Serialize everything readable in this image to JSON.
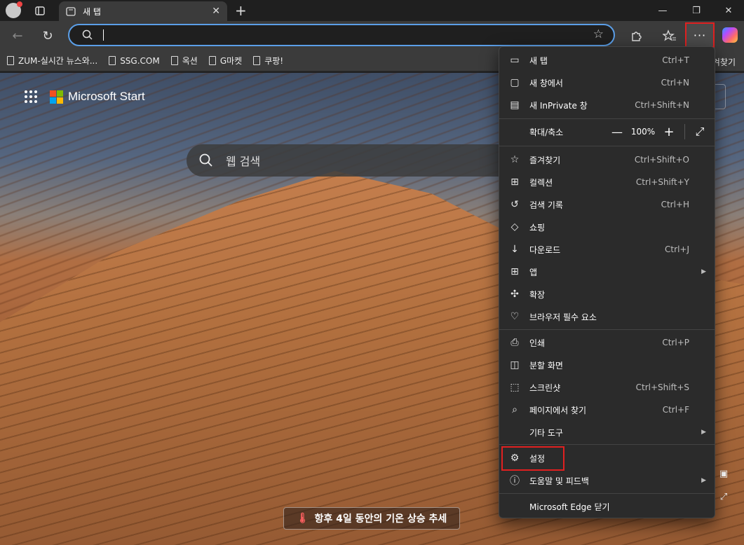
{
  "tab": {
    "title": "새 탭"
  },
  "bookmarks": [
    {
      "label": "ZUM-실시간 뉴스와..."
    },
    {
      "label": "SSG.COM"
    },
    {
      "label": "옥션"
    },
    {
      "label": "G마켓"
    },
    {
      "label": "쿠팡!"
    }
  ],
  "bookmarks_right": "즐겨찾기",
  "page": {
    "brand": "Microsoft Start",
    "search_placeholder": "웹 검색",
    "trend": "항후 4일 동안의 기온 상승 추세"
  },
  "menu": {
    "items": [
      {
        "label": "새 탭",
        "shortcut": "Ctrl+T",
        "icon": "new-tab-icon"
      },
      {
        "label": "새 창에서",
        "shortcut": "Ctrl+N",
        "icon": "new-window-icon"
      },
      {
        "label": "새 InPrivate 창",
        "shortcut": "Ctrl+Shift+N",
        "icon": "inprivate-icon"
      },
      {
        "label": "즐겨찾기",
        "shortcut": "Ctrl+Shift+O",
        "icon": "favorites-icon"
      },
      {
        "label": "컬렉션",
        "shortcut": "Ctrl+Shift+Y",
        "icon": "collections-icon"
      },
      {
        "label": "검색 기록",
        "shortcut": "Ctrl+H",
        "icon": "history-icon"
      },
      {
        "label": "쇼핑",
        "shortcut": "",
        "icon": "shopping-icon"
      },
      {
        "label": "다운로드",
        "shortcut": "Ctrl+J",
        "icon": "download-icon"
      },
      {
        "label": "앱",
        "shortcut": "",
        "icon": "apps-icon"
      },
      {
        "label": "확장",
        "shortcut": "",
        "icon": "extensions-icon"
      },
      {
        "label": "브라우저 필수 요소",
        "shortcut": "",
        "icon": "essentials-icon"
      },
      {
        "label": "인쇄",
        "shortcut": "Ctrl+P",
        "icon": "print-icon"
      },
      {
        "label": "분할 화면",
        "shortcut": "",
        "icon": "split-screen-icon"
      },
      {
        "label": "스크린샷",
        "shortcut": "Ctrl+Shift+S",
        "icon": "screenshot-icon"
      },
      {
        "label": "페이지에서 찾기",
        "shortcut": "Ctrl+F",
        "icon": "find-icon"
      },
      {
        "label": "기타 도구",
        "shortcut": "",
        "icon": ""
      },
      {
        "label": "설정",
        "shortcut": "",
        "icon": "settings-icon"
      },
      {
        "label": "도움말 및 피드백",
        "shortcut": "",
        "icon": "help-icon"
      },
      {
        "label": "Microsoft Edge 닫기",
        "shortcut": "",
        "icon": ""
      }
    ],
    "zoom": {
      "label": "확대/축소",
      "value": "100%"
    }
  }
}
